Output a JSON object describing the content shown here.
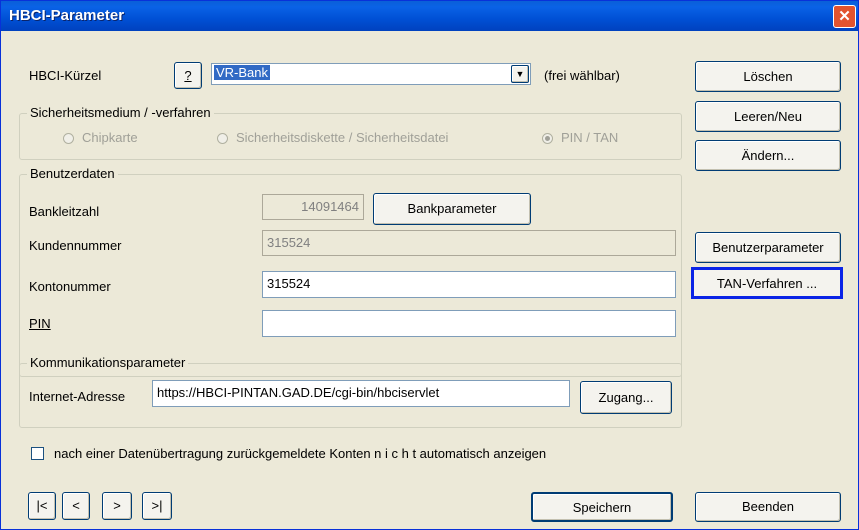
{
  "window": {
    "title": "HBCI-Parameter",
    "close_glyph": "✕"
  },
  "hbci": {
    "label": "HBCI-Kürzel",
    "help_label": "?",
    "selected_value": "VR-Bank",
    "hint": "(frei wählbar)"
  },
  "security": {
    "legend": "Sicherheitsmedium / -verfahren",
    "options": [
      {
        "label": "Chipkarte",
        "selected": false
      },
      {
        "label": "Sicherheitsdiskette / Sicherheitsdatei",
        "selected": false
      },
      {
        "label": "PIN / TAN",
        "selected": true
      }
    ]
  },
  "user": {
    "legend": "Benutzerdaten",
    "blz_label": "Bankleitzahl",
    "blz_value": "14091464",
    "bankparameter_label": "Bankparameter",
    "kunden_label": "Kundennummer",
    "kunden_value": "315524",
    "konto_label": "Kontonummer",
    "konto_value": "315524",
    "pin_label": "PIN",
    "pin_value": ""
  },
  "comm": {
    "legend": "Kommunikationsparameter",
    "address_label": "Internet-Adresse",
    "address_value": "https://HBCI-PINTAN.GAD.DE/cgi-bin/hbciservlet",
    "zugang_label": "Zugang..."
  },
  "checkbox": {
    "label": "nach einer Datenübertragung zurückgemeldete Konten  n i c h t  automatisch anzeigen",
    "checked": false
  },
  "side_buttons": {
    "loeschen": "Löschen",
    "leeren": "Leeren/Neu",
    "aendern": "Ändern...",
    "benutzerparameter": "Benutzerparameter",
    "tan_verfahren": "TAN-Verfahren ..."
  },
  "nav": {
    "first": "|<",
    "prev": "<",
    "next": ">",
    "last": ">|"
  },
  "footer": {
    "save": "Speichern",
    "exit": "Beenden"
  },
  "colors": {
    "focus_highlight": "#0a24e6",
    "selection": "#316ac5"
  }
}
